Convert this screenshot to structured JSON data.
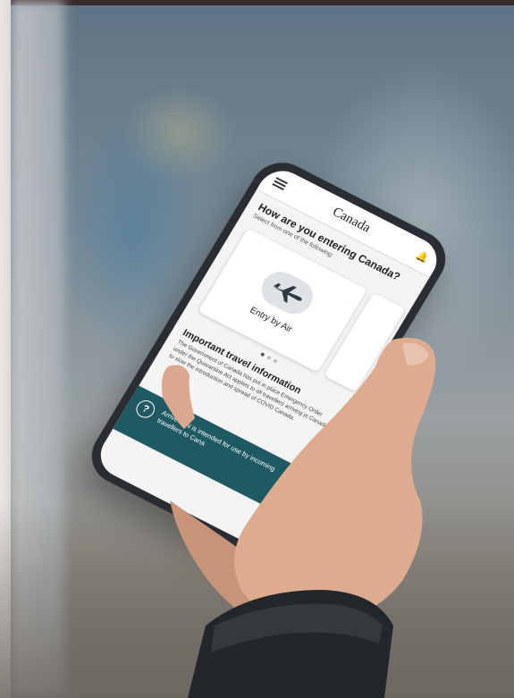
{
  "app": {
    "brand": "Canada",
    "question": "How are you entering Canada?",
    "instruction": "Select from one of the following:"
  },
  "cards": [
    {
      "label": "Entry by Air",
      "icon": "airplane-icon"
    }
  ],
  "carousel": {
    "count": 3,
    "active": 0
  },
  "info": {
    "heading": "Important travel information",
    "body": "The Government of Canada has put in place Emergency Order under the Quarantine Act applies to all travellers arriving in Canada to slow the introduction and spread of COVID Canada."
  },
  "banner": {
    "text": "ArriveCAN is intended for use by incoming travellers to Cana"
  },
  "colors": {
    "banner": "#1f5a63",
    "flag_red": "#d52b1e"
  }
}
